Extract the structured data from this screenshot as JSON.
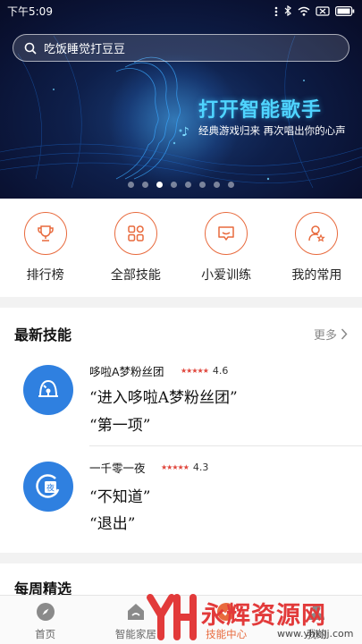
{
  "status_bar": {
    "time": "下午5:09"
  },
  "search": {
    "placeholder": "吃饭睡觉打豆豆"
  },
  "banner": {
    "title": "打开智能歌手",
    "subtitle": "经典游戏归来 再次唱出你的心声",
    "page_count": 8,
    "active_index": 2
  },
  "quick_actions": [
    {
      "label": "排行榜",
      "icon": "trophy-icon"
    },
    {
      "label": "全部技能",
      "icon": "grid-icon"
    },
    {
      "label": "小爱训练",
      "icon": "chat-bubble-icon"
    },
    {
      "label": "我的常用",
      "icon": "user-star-icon"
    }
  ],
  "latest": {
    "title": "最新技能",
    "more": "更多",
    "skills": [
      {
        "name": "哆啦A梦粉丝团",
        "rating": "4.6",
        "icon": "bell-icon",
        "commands": [
          "“进入哆啦A梦粉丝团”",
          "“第一项”"
        ]
      },
      {
        "name": "一千零一夜",
        "rating": "4.3",
        "icon": "book-icon",
        "commands": [
          "“不知道”",
          "“退出”"
        ]
      }
    ]
  },
  "weekly": {
    "title": "每周精选"
  },
  "bottom_nav": [
    {
      "label": "首页",
      "icon": "compass-icon"
    },
    {
      "label": "智能家居",
      "icon": "home-icon"
    },
    {
      "label": "技能中心",
      "icon": "skill-center-icon"
    },
    {
      "label": "我的",
      "icon": "profile-icon"
    }
  ],
  "watermark": {
    "brand": "永辉资源网",
    "url": "www.yhkjjj.com"
  },
  "colors": {
    "accent": "#e86a3d",
    "banner_title": "#4fd4ff",
    "skill_icon_bg": "#2f80e0"
  }
}
